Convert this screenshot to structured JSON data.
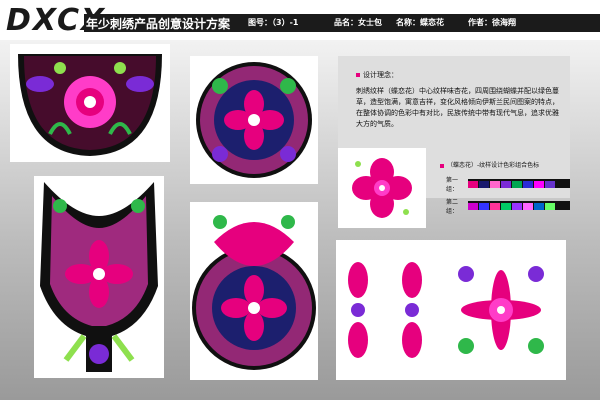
{
  "header": {
    "logo": "DXCX",
    "title": "年少刺绣产品创意设计方案",
    "figure_no": "图号：（3）-1",
    "product": "品名：女士包",
    "pattern_name": "名称：蝶恋花",
    "author": "作者：徐海翔"
  },
  "concept": {
    "heading": "设计理念：",
    "body": "刺绣纹样（蝶恋花）中心纹样味杏花，四周围绕蝴蝶并配以绿色蔓草，造型饱满，寓意吉祥，变化风格倾向伊斯兰民间图案的特点，在整体协调的色彩中有对比，民族传统中带有现代气息，追求优雅大方的气质。"
  },
  "palette": {
    "title": "（蝶恋花）-纹样设计色彩组合色标",
    "group1_label": "第一组：",
    "group2_label": "第二组：",
    "group1": [
      "#e6007e",
      "#1a1a6e",
      "#ff66cc",
      "#7b2bd6",
      "#00a651",
      "#2b2bd6",
      "#ff00ff",
      "#6633cc"
    ],
    "group2": [
      "#cc00cc",
      "#3333ff",
      "#ff3399",
      "#00cc66",
      "#9933ff",
      "#ff66ff",
      "#0066cc",
      "#66ff66"
    ]
  },
  "colors": {
    "pink": "#e6007e",
    "magenta": "#ff3cc8",
    "purple": "#7a2bd6",
    "navy": "#1c1f6e",
    "green": "#2fb84a",
    "lime": "#8ee04e",
    "black": "#101010"
  }
}
